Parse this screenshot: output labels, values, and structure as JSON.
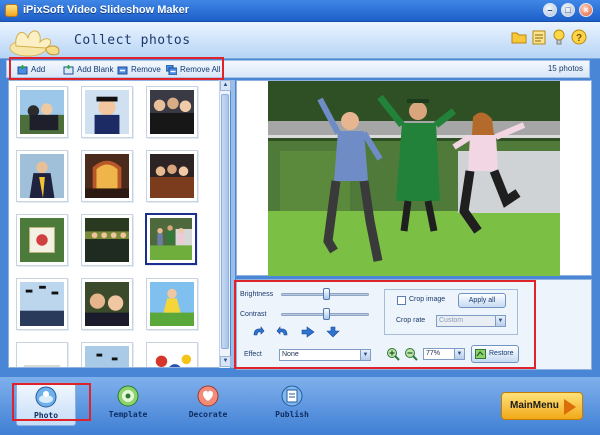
{
  "window": {
    "title": "iPixSoft Video Slideshow Maker",
    "buttons": [
      "–",
      "□",
      "×"
    ]
  },
  "header": {
    "title": "Collect photos",
    "icons": [
      "folder-icon",
      "list-icon",
      "light-bulb-icon",
      "help-icon"
    ]
  },
  "toolbar": {
    "add_label": "Add",
    "add_blank_label": "Add Blank",
    "remove_label": "Remove",
    "remove_all_label": "Remove All",
    "photo_count": "15 photos"
  },
  "photos": {
    "thumbnails": [
      "graduates-group",
      "graduate-smiling",
      "graduates-crowd",
      "graduate-portrait",
      "stained-glass-hall",
      "graduates-party",
      "diploma",
      "ceremony-hall",
      "jumping-graduates",
      "caps-in-air",
      "graduates-faces",
      "girl-jumping",
      "caps-toss",
      "graduates-cheer",
      "balloons"
    ],
    "selected_index": 8
  },
  "adjust": {
    "brightness_label": "Brightness",
    "contrast_label": "Contrast",
    "brightness_value": 0.52,
    "contrast_value": 0.52,
    "effect_label": "Effect",
    "effect_value": "None",
    "crop_image_label": "Crop image",
    "crop_image_checked": false,
    "crop_rate_label": "Crop rate",
    "crop_rate_value": "Custom",
    "apply_all_label": "Apply all",
    "zoom_value": "77%",
    "restore_label": "Restore"
  },
  "nav": {
    "photo_label": "Photo",
    "template_label": "Template",
    "decorate_label": "Decorate",
    "publish_label": "Publish",
    "main_menu_label": "MainMenu",
    "active": "Photo"
  },
  "colors": {
    "highlight": "#e0222a",
    "title_bar": "#2b6fd8",
    "main_menu": "#f5b325"
  }
}
